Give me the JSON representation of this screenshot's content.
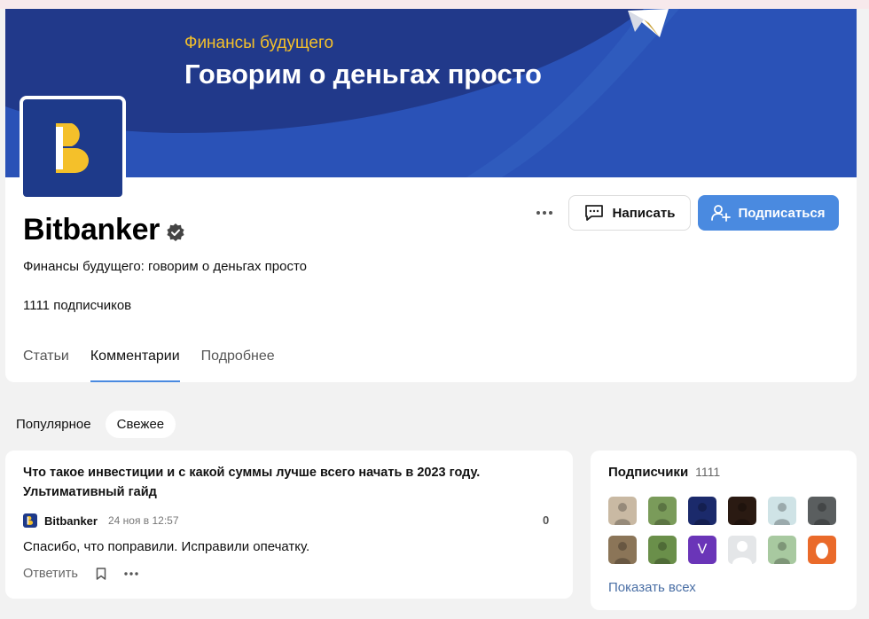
{
  "cover": {
    "subtitle": "Финансы будущего",
    "title": "Говорим о деньгах просто"
  },
  "profile": {
    "name": "Bitbanker",
    "description": "Финансы будущего: говорим о деньгах просто",
    "subscribers": "1111 подписчиков"
  },
  "actions": {
    "write_label": "Написать",
    "subscribe_label": "Подписаться"
  },
  "tabs": [
    {
      "label": "Статьи",
      "active": false
    },
    {
      "label": "Комментарии",
      "active": true
    },
    {
      "label": "Подробнее",
      "active": false
    }
  ],
  "filters": [
    {
      "label": "Популярное",
      "active": false
    },
    {
      "label": "Свежее",
      "active": true
    }
  ],
  "comment": {
    "title": "Что такое инвестиции и с какой суммы лучше всего начать в 2023 году. Ультимативный гайд",
    "author": "Bitbanker",
    "date": "24 ноя в 12:57",
    "score": "0",
    "text": "Спасибо, что поправили. Исправили опечатку.",
    "reply_label": "Ответить"
  },
  "subscribers_widget": {
    "title": "Подписчики",
    "count": "1111",
    "show_all_label": "Показать всех",
    "avatars": [
      {
        "name": "subscriber-avatar-photo",
        "color": "#c9b9a3"
      },
      {
        "name": "subscriber-avatar-nature",
        "color": "#7a9b5a"
      },
      {
        "name": "subscriber-avatar-portrait",
        "color": "#1b2a6b"
      },
      {
        "name": "subscriber-avatar-portrait",
        "color": "#2a1a12"
      },
      {
        "name": "subscriber-avatar-beach",
        "color": "#cfe3e6"
      },
      {
        "name": "subscriber-avatar-silhouette",
        "color": "#5a5e5f"
      },
      {
        "name": "subscriber-avatar-person",
        "color": "#8b7558"
      },
      {
        "name": "subscriber-avatar-flowers",
        "color": "#6a8f4a"
      },
      {
        "name": "subscriber-avatar-letter",
        "color": "#6a35b8",
        "letter": "V"
      },
      {
        "name": "subscriber-avatar-default",
        "color": "#e4e6e8"
      },
      {
        "name": "subscriber-avatar-person",
        "color": "#a8c9a0"
      },
      {
        "name": "subscriber-avatar-egg",
        "color": "#ea6a2a"
      }
    ]
  },
  "colors": {
    "brand_blue": "#2a52b7",
    "accent": "#4a8ae0",
    "logo_yellow": "#f4c02a"
  }
}
